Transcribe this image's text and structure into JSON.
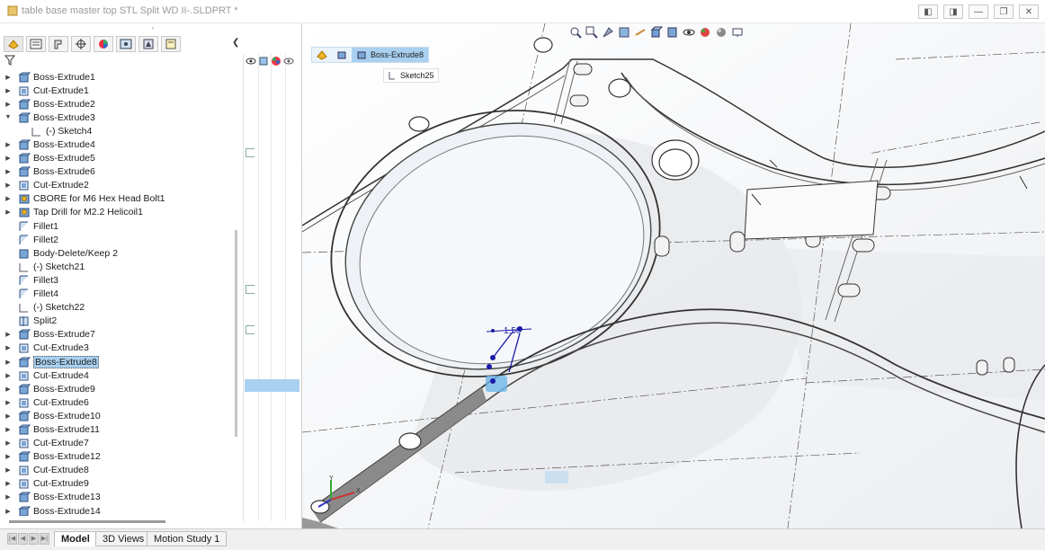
{
  "window": {
    "title": "table base master top STL Split WD II-.SLDPRT *"
  },
  "feature_tree": {
    "items": [
      {
        "label": "Boss-Extrude1",
        "icon": "boss-extrude-icon",
        "expandable": true
      },
      {
        "label": "Cut-Extrude1",
        "icon": "cut-extrude-icon",
        "expandable": true
      },
      {
        "label": "Boss-Extrude2",
        "icon": "boss-extrude-icon",
        "expandable": true
      },
      {
        "label": "Boss-Extrude3",
        "icon": "boss-extrude-icon",
        "expandable": true,
        "expanded": true
      },
      {
        "label": "(-) Sketch4",
        "icon": "sketch-icon",
        "expandable": false,
        "child": true
      },
      {
        "label": "Boss-Extrude4",
        "icon": "boss-extrude-icon",
        "expandable": true
      },
      {
        "label": "Boss-Extrude5",
        "icon": "boss-extrude-icon",
        "expandable": true
      },
      {
        "label": "Boss-Extrude6",
        "icon": "boss-extrude-icon",
        "expandable": true
      },
      {
        "label": "Cut-Extrude2",
        "icon": "cut-extrude-icon",
        "expandable": true
      },
      {
        "label": "CBORE for M6 Hex Head Bolt1",
        "icon": "hole-wizard-icon",
        "expandable": true
      },
      {
        "label": "Tap Drill for M2.2 Helicoil1",
        "icon": "hole-wizard-icon",
        "expandable": true
      },
      {
        "label": "Fillet1",
        "icon": "fillet-icon",
        "expandable": false
      },
      {
        "label": "Fillet2",
        "icon": "fillet-icon",
        "expandable": false
      },
      {
        "label": "Body-Delete/Keep 2",
        "icon": "body-delete-icon",
        "expandable": false
      },
      {
        "label": "(-) Sketch21",
        "icon": "sketch-icon",
        "expandable": false
      },
      {
        "label": "Fillet3",
        "icon": "fillet-icon",
        "expandable": false
      },
      {
        "label": "Fillet4",
        "icon": "fillet-icon",
        "expandable": false
      },
      {
        "label": "(-) Sketch22",
        "icon": "sketch-icon",
        "expandable": false
      },
      {
        "label": "Split2",
        "icon": "split-icon",
        "expandable": false
      },
      {
        "label": "Boss-Extrude7",
        "icon": "boss-extrude-icon",
        "expandable": true
      },
      {
        "label": "Cut-Extrude3",
        "icon": "cut-extrude-icon",
        "expandable": true
      },
      {
        "label": "Boss-Extrude8",
        "icon": "boss-extrude-icon",
        "expandable": true,
        "selected": true
      },
      {
        "label": "Cut-Extrude4",
        "icon": "cut-extrude-icon",
        "expandable": true
      },
      {
        "label": "Boss-Extrude9",
        "icon": "boss-extrude-icon",
        "expandable": true
      },
      {
        "label": "Cut-Extrude6",
        "icon": "cut-extrude-icon",
        "expandable": true
      },
      {
        "label": "Boss-Extrude10",
        "icon": "boss-extrude-icon",
        "expandable": true
      },
      {
        "label": "Boss-Extrude11",
        "icon": "boss-extrude-icon",
        "expandable": true
      },
      {
        "label": "Cut-Extrude7",
        "icon": "cut-extrude-icon",
        "expandable": true
      },
      {
        "label": "Boss-Extrude12",
        "icon": "boss-extrude-icon",
        "expandable": true
      },
      {
        "label": "Cut-Extrude8",
        "icon": "cut-extrude-icon",
        "expandable": true
      },
      {
        "label": "Cut-Extrude9",
        "icon": "cut-extrude-icon",
        "expandable": true
      },
      {
        "label": "Boss-Extrude13",
        "icon": "boss-extrude-icon",
        "expandable": true
      },
      {
        "label": "Boss-Extrude14",
        "icon": "boss-extrude-icon",
        "expandable": true
      }
    ]
  },
  "viewport": {
    "breadcrumb_feature": "Boss-Extrude8",
    "breadcrumb_sketch": "Sketch25",
    "dimension": "1.50",
    "triad_x": "X",
    "triad_y": "Y"
  },
  "bottom_tabs": [
    {
      "label": "Model",
      "active": true
    },
    {
      "label": "3D Views",
      "active": false
    },
    {
      "label": "Motion Study 1",
      "active": false
    }
  ],
  "colors": {
    "selection": "#a9d0f0",
    "feature_icon": "#4a7fc1",
    "dimension": "#1a1aa8"
  }
}
